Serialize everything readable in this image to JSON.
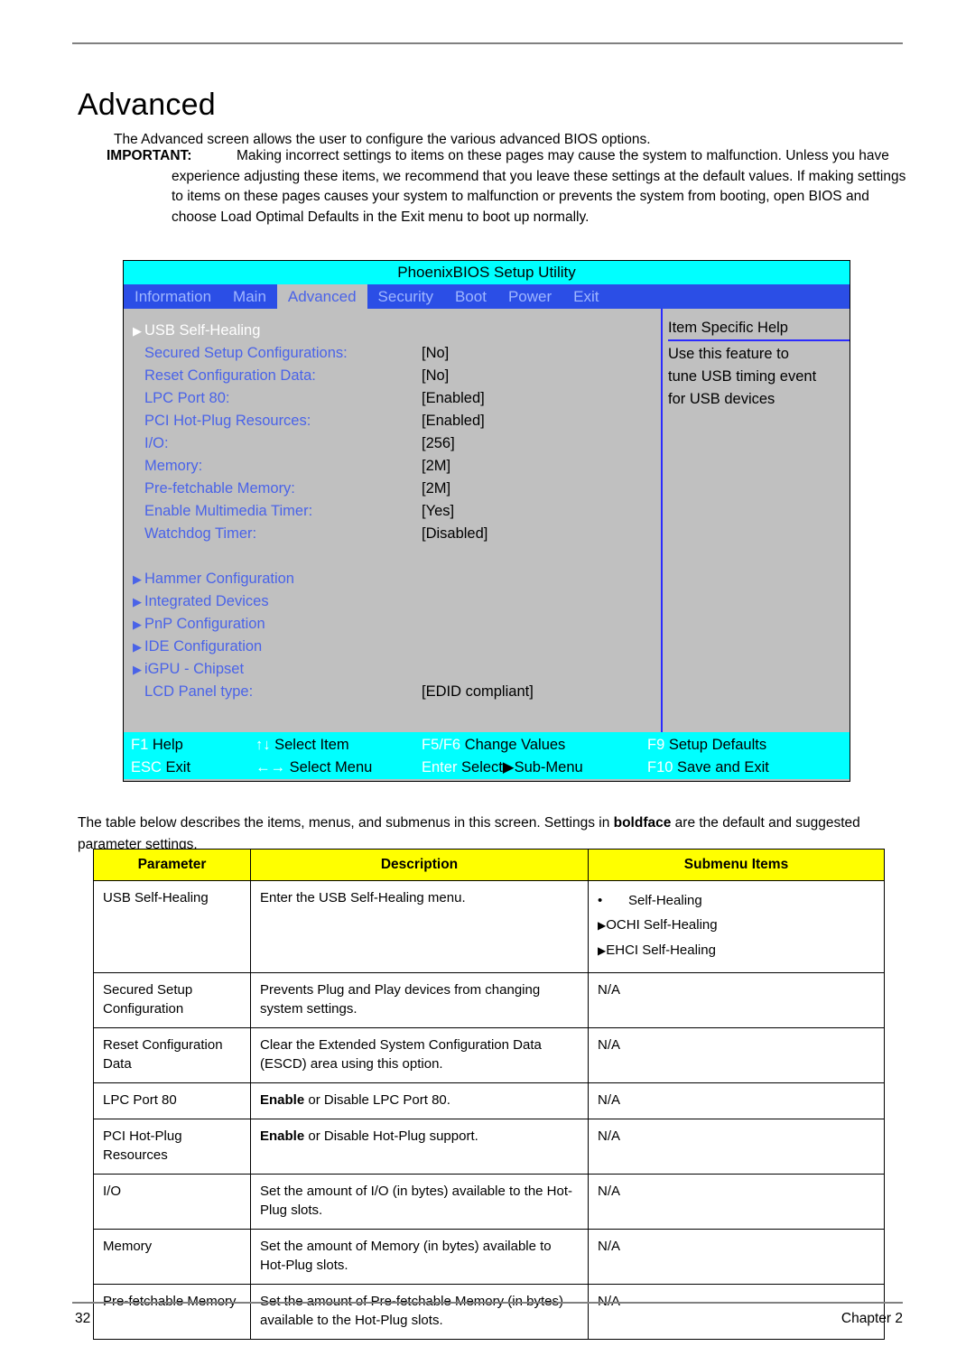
{
  "page": {
    "title": "Advanced",
    "intro": "The Advanced screen allows the user to configure the various advanced BIOS options.",
    "important_label": "IMPORTANT:",
    "important_body": "Making incorrect settings to items on these pages may cause the system to malfunction. Unless you have experience adjusting these items, we recommend that you leave these settings at the default values. If making settings to items on these pages causes your system to malfunction or prevents the system from booting, open BIOS and choose Load Optimal Defaults in the Exit menu to boot up normally.",
    "table_intro_before": "The table below describes the items, menus, and submenus in this screen. Settings in ",
    "table_intro_bold": "boldface",
    "table_intro_after": " are the default and suggested parameter settings.",
    "folio_page": "32",
    "folio_chapter": "Chapter 2"
  },
  "bios": {
    "title": "PhoenixBIOS Setup Utility",
    "menu": [
      {
        "label": "Information",
        "active": false
      },
      {
        "label": "Main",
        "active": false
      },
      {
        "label": "Advanced",
        "active": true
      },
      {
        "label": "Security",
        "active": false
      },
      {
        "label": "Boot",
        "active": false
      },
      {
        "label": "Power",
        "active": false
      },
      {
        "label": "Exit",
        "active": false
      }
    ],
    "options": [
      {
        "arrow": "▶",
        "arrow_color": "white",
        "label": "USB Self-Healing",
        "label_color": "white",
        "value": ""
      },
      {
        "arrow": "",
        "arrow_color": "blue",
        "label": "Secured Setup Configurations:",
        "label_color": "blue",
        "value": "[No]"
      },
      {
        "arrow": "",
        "arrow_color": "blue",
        "label": "Reset Configuration Data:",
        "label_color": "blue",
        "value": "[No]"
      },
      {
        "arrow": "",
        "arrow_color": "blue",
        "label": "LPC Port 80:",
        "label_color": "blue",
        "value": "[Enabled]"
      },
      {
        "arrow": "",
        "arrow_color": "blue",
        "label": "PCI Hot-Plug Resources:",
        "label_color": "blue",
        "value": "[Enabled]"
      },
      {
        "arrow": "",
        "arrow_color": "blue",
        "label": "I/O:",
        "label_color": "blue",
        "value": "[256]"
      },
      {
        "arrow": "",
        "arrow_color": "blue",
        "label": "Memory:",
        "label_color": "blue",
        "value": "[2M]"
      },
      {
        "arrow": "",
        "arrow_color": "blue",
        "label": "Pre-fetchable Memory:",
        "label_color": "blue",
        "value": "[2M]"
      },
      {
        "arrow": "",
        "arrow_color": "blue",
        "label": "Enable Multimedia Timer:",
        "label_color": "blue",
        "value": "[Yes]"
      },
      {
        "arrow": "",
        "arrow_color": "blue",
        "label": "Watchdog Timer:",
        "label_color": "blue",
        "value": "[Disabled]"
      },
      {
        "arrow": "",
        "arrow_color": "blue",
        "label": "",
        "label_color": "blue",
        "value": ""
      },
      {
        "arrow": "▶",
        "arrow_color": "blue",
        "label": "Hammer Configuration",
        "label_color": "blue",
        "value": ""
      },
      {
        "arrow": "▶",
        "arrow_color": "blue",
        "label": "Integrated Devices",
        "label_color": "blue",
        "value": ""
      },
      {
        "arrow": "▶",
        "arrow_color": "blue",
        "label": "PnP Configuration",
        "label_color": "blue",
        "value": ""
      },
      {
        "arrow": "▶",
        "arrow_color": "blue",
        "label": "IDE Configuration",
        "label_color": "blue",
        "value": ""
      },
      {
        "arrow": "▶",
        "arrow_color": "blue",
        "label": "iGPU - Chipset",
        "label_color": "blue",
        "value": ""
      },
      {
        "arrow": "",
        "arrow_color": "blue",
        "label": "LCD Panel type:",
        "label_color": "blue",
        "value": "[EDID compliant]"
      }
    ],
    "help": {
      "title": "Item Specific Help",
      "lines": [
        "Use this feature to",
        "tune USB timing event",
        "for USB devices"
      ]
    },
    "footer_keys": [
      {
        "key": "F1",
        "desc": "Help"
      },
      {
        "key": "↑↓",
        "desc": "Select Item"
      },
      {
        "key": "F5/F6",
        "desc": "Change Values"
      },
      {
        "key": "F9",
        "desc": "Setup Defaults"
      },
      {
        "key": "ESC",
        "desc": "Exit"
      },
      {
        "key": "←→",
        "desc": "Select Menu"
      },
      {
        "key": "Enter",
        "desc": "Select▶Sub-Menu"
      },
      {
        "key": "F10",
        "desc": "Save and Exit"
      }
    ]
  },
  "table": {
    "headers": [
      "Parameter",
      "Description",
      "Submenu Items"
    ],
    "rows": [
      {
        "parameter": "USB Self-Healing",
        "description": "Enter the USB Self-Healing menu.",
        "description_bold": "",
        "description_rest": "",
        "submenu": [
          "Self-Healing",
          "OCHI Self-Healing",
          "EHCI Self-Healing"
        ],
        "submenu_kind": "list"
      },
      {
        "parameter": "Secured Setup Configuration",
        "description": "Prevents Plug and Play devices from changing system settings.",
        "description_bold": "",
        "description_rest": "",
        "submenu": [
          "N/A"
        ],
        "submenu_kind": "plain"
      },
      {
        "parameter": "Reset Configuration Data",
        "description": "Clear the Extended System Configuration Data (ESCD) area using this option.",
        "description_bold": "",
        "description_rest": "",
        "submenu": [
          "N/A"
        ],
        "submenu_kind": "plain"
      },
      {
        "parameter": "LPC Port 80",
        "description": "",
        "description_bold": "Enable",
        "description_rest": " or Disable LPC Port 80.",
        "submenu": [
          "N/A"
        ],
        "submenu_kind": "plain"
      },
      {
        "parameter": "PCI Hot-Plug Resources",
        "description": "",
        "description_bold": "Enable",
        "description_rest": " or Disable Hot-Plug support.",
        "submenu": [
          "N/A"
        ],
        "submenu_kind": "plain"
      },
      {
        "parameter": "I/O",
        "description": "Set the amount of I/O (in bytes) available to the Hot-Plug slots.",
        "description_bold": "",
        "description_rest": "",
        "submenu": [
          "N/A"
        ],
        "submenu_kind": "plain"
      },
      {
        "parameter": "Memory",
        "description": "Set the amount of Memory (in bytes) available to Hot-Plug slots.",
        "description_bold": "",
        "description_rest": "",
        "submenu": [
          "N/A"
        ],
        "submenu_kind": "plain"
      },
      {
        "parameter": "Pre-fetchable Memory",
        "description": "Set the amount of Pre-fetchable Memory (in bytes) available to the Hot-Plug slots.",
        "description_bold": "",
        "description_rest": "",
        "submenu": [
          "N/A"
        ],
        "submenu_kind": "plain"
      }
    ]
  }
}
